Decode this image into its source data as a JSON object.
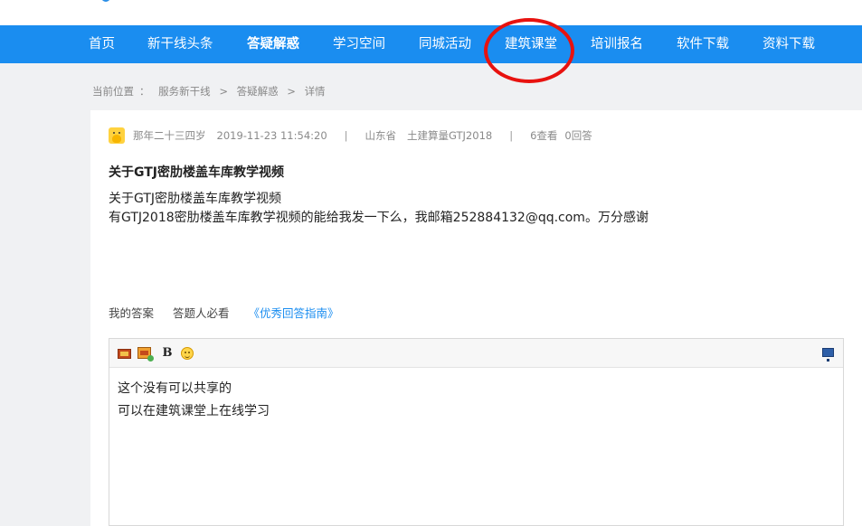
{
  "nav": {
    "items": [
      {
        "label": "首页"
      },
      {
        "label": "新干线头条"
      },
      {
        "label": "答疑解惑",
        "active": true
      },
      {
        "label": "学习空间"
      },
      {
        "label": "同城活动"
      },
      {
        "label": "建筑课堂",
        "highlighted": true
      },
      {
        "label": "培训报名"
      },
      {
        "label": "软件下载"
      },
      {
        "label": "资料下载"
      }
    ],
    "bg_color": "#1a8df0",
    "highlight_color": "#e8120f"
  },
  "breadcrumb": {
    "label": "当前位置",
    "colon": "：",
    "items": [
      "服务新干线",
      "答疑解惑",
      "详情"
    ],
    "separator": ">"
  },
  "question": {
    "author": "那年二十三四岁",
    "datetime": "2019-11-23 11:54:20",
    "divider": "|",
    "province": "山东省",
    "category": "土建算量GTJ2018",
    "views": "6查看",
    "answers": "0回答",
    "title": "关于GTJ密肋楼盖车库教学视频",
    "body_line1": "关于GTJ密肋楼盖车库教学视频",
    "body_line2": "有GTJ2018密肋楼盖车库教学视频的能给我发一下么，我邮箱252884132@qq.com。万分感谢"
  },
  "answer_section": {
    "my_answer": "我的答案",
    "must_read": "答题人必看",
    "guide_link": "《优秀回答指南》"
  },
  "editor": {
    "toolbar": {
      "bold_label": "B",
      "icons": [
        "image-icon",
        "image-upload-icon",
        "bold-icon",
        "emoji-icon",
        "fullscreen-icon"
      ]
    },
    "content_line1": "这个没有可以共享的",
    "content_line2": "可以在建筑课堂上在线学习"
  }
}
